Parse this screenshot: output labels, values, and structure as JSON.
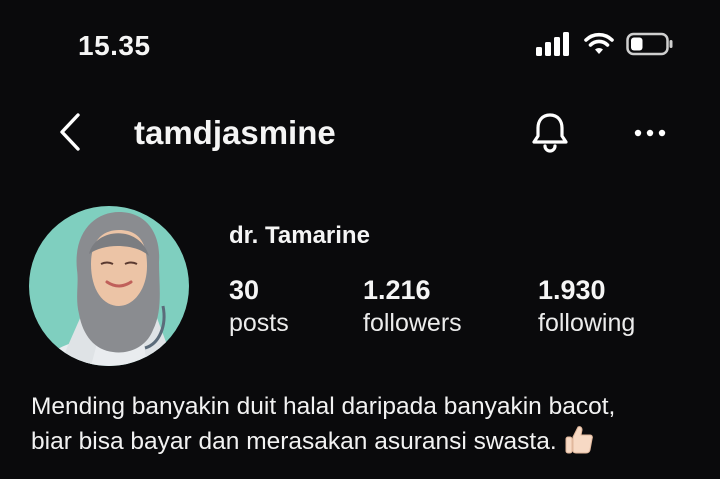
{
  "status_bar": {
    "time": "15.35",
    "icons": [
      "cellular-signal-icon",
      "wifi-icon",
      "battery-icon"
    ],
    "battery_level": 0.35
  },
  "header": {
    "username": "tamdjasmine",
    "back_icon": "chevron-left-icon",
    "notification_icon": "bell-icon",
    "more_icon": "ellipsis-icon"
  },
  "profile": {
    "display_name": "dr. Tamarine",
    "stats": {
      "posts": {
        "count": "30",
        "label": "posts"
      },
      "followers": {
        "count": "1.216",
        "label": "followers"
      },
      "following": {
        "count": "1.930",
        "label": "following"
      }
    },
    "bio": {
      "line1": "Mending banyakin duit halal daripada banyakin bacot,",
      "line2": "biar bisa bayar dan merasakan asuransi swasta.",
      "emoji_icon": "thumbs-up-icon"
    }
  },
  "colors": {
    "background": "#0a0a0c",
    "text": "#f5f5f5",
    "avatar_background": "#7fcfbf"
  }
}
